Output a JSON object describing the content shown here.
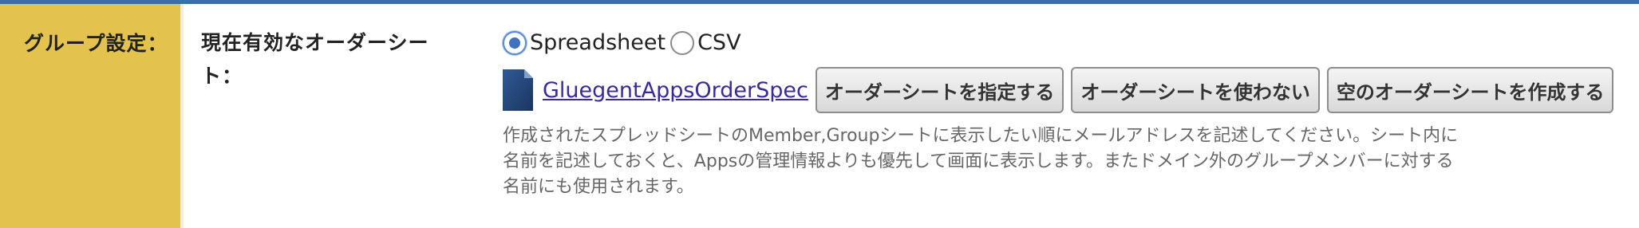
{
  "section": {
    "label": "グループ設定："
  },
  "field": {
    "label_line1": "現在有効なオーダーシー",
    "label_line2": "ト："
  },
  "format_options": [
    {
      "label": "Spreadsheet",
      "selected": true
    },
    {
      "label": "CSV",
      "selected": false
    }
  ],
  "file": {
    "icon": "document-icon",
    "name": "GluegentAppsOrderSpec"
  },
  "buttons": {
    "specify": "オーダーシートを指定する",
    "not_use": "オーダーシートを使わない",
    "create_empty": "空のオーダーシートを作成する"
  },
  "help": {
    "line1": "作成されたスプレッドシートのMember,Groupシートに表示したい順にメールアドレスを記述してください。シート内に",
    "line2": "名前を記述しておくと、Appsの管理情報よりも優先して画面に表示します。またドメイン外のグループメンバーに対する",
    "line3": "名前にも使用されます。"
  },
  "colors": {
    "top_bar": "#3a6ea5",
    "section_bg": "#e4c24e",
    "link": "#3b2a9c",
    "help_text": "#666666"
  }
}
